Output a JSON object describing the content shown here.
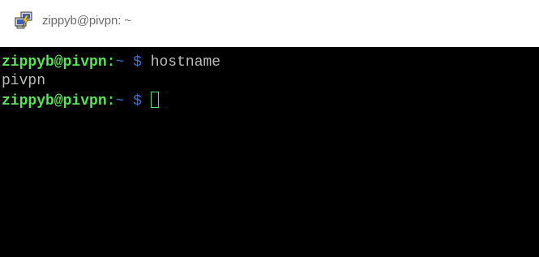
{
  "window": {
    "title": "zippyb@pivpn: ~",
    "icon": "putty-icon"
  },
  "terminal": {
    "lines": [
      {
        "prompt_user": "zippyb@pivpn:",
        "prompt_path": "~",
        "prompt_symbol": "$",
        "command": "hostname"
      },
      {
        "output": "pivpn"
      },
      {
        "prompt_user": "zippyb@pivpn:",
        "prompt_path": "~",
        "prompt_symbol": "$",
        "command": ""
      }
    ]
  },
  "colors": {
    "background": "#000000",
    "prompt_user": "#54e653",
    "prompt_path": "#3a6fd8",
    "text": "#bbbbbb"
  }
}
